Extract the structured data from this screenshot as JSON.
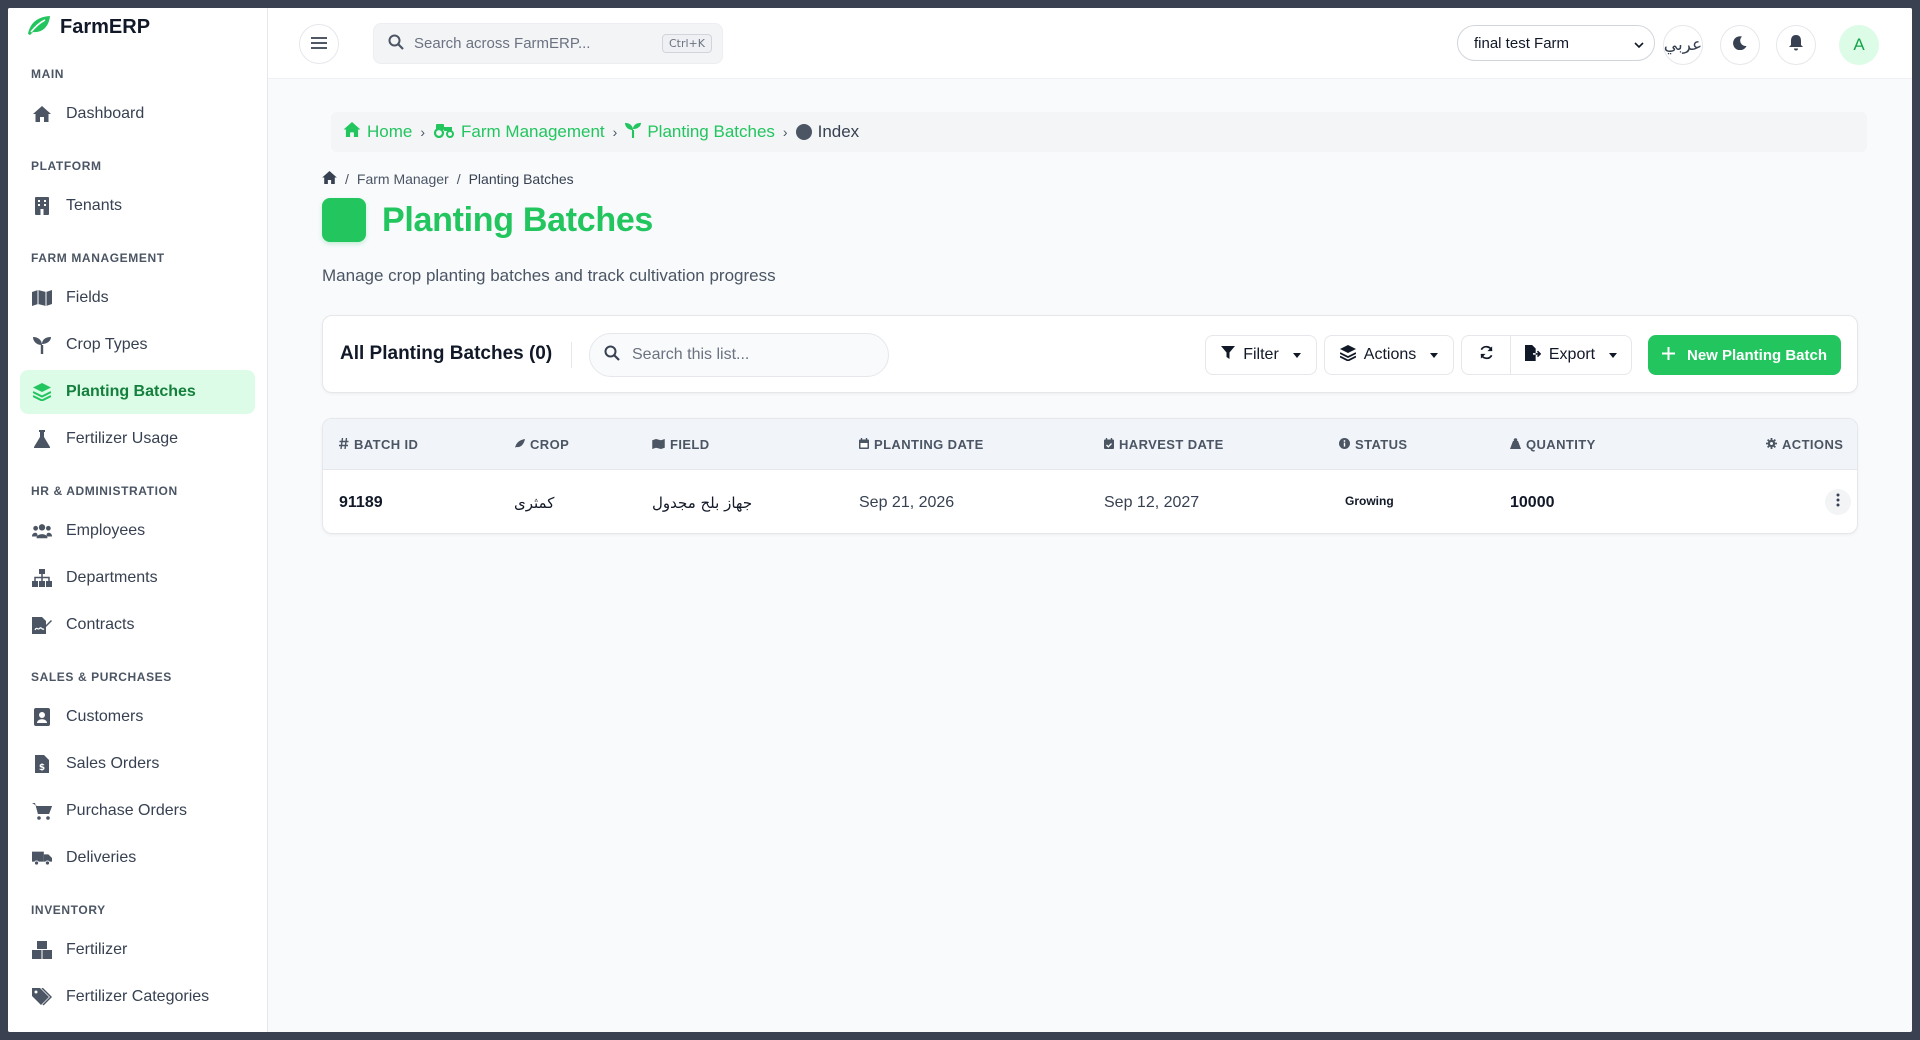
{
  "brand": {
    "name": "FarmERP"
  },
  "sidebar": {
    "sections": {
      "main": "MAIN",
      "platform": "PLATFORM",
      "farm_management": "FARM MANAGEMENT",
      "hr": "HR & ADMINISTRATION",
      "sales": "SALES & PURCHASES",
      "inventory": "INVENTORY"
    },
    "items": {
      "dashboard": "Dashboard",
      "tenants": "Tenants",
      "fields": "Fields",
      "crop_types": "Crop Types",
      "planting_batches": "Planting Batches",
      "fertilizer_usage": "Fertilizer Usage",
      "employees": "Employees",
      "departments": "Departments",
      "contracts": "Contracts",
      "customers": "Customers",
      "sales_orders": "Sales Orders",
      "purchase_orders": "Purchase Orders",
      "deliveries": "Deliveries",
      "fertilizer": "Fertilizer",
      "fertilizer_categories": "Fertilizer Categories"
    },
    "active": "planting_batches"
  },
  "topbar": {
    "search_placeholder": "Search across FarmERP...",
    "search_shortcut": "Ctrl+K",
    "farm_selected": "final test Farm",
    "language_label": "عربي",
    "avatar_initial": "A"
  },
  "breadcrumb": {
    "home": "Home",
    "farm_management": "Farm Management",
    "planting_batches": "Planting Batches",
    "current": "Index"
  },
  "sub_breadcrumb": {
    "farm_manager": "Farm Manager",
    "current": "Planting Batches"
  },
  "page": {
    "title": "Planting Batches",
    "description": "Manage crop planting batches and track cultivation progress"
  },
  "toolbar": {
    "list_title": "All Planting Batches (0)",
    "search_placeholder": "Search this list...",
    "filter_label": "Filter",
    "actions_label": "Actions",
    "export_label": "Export",
    "new_label": "New Planting Batch"
  },
  "table": {
    "headers": {
      "batch_id": "BATCH ID",
      "crop": "CROP",
      "field": "FIELD",
      "planting_date": "PLANTING DATE",
      "harvest_date": "HARVEST DATE",
      "status": "STATUS",
      "quantity": "QUANTITY",
      "actions": "ACTIONS"
    },
    "rows": [
      {
        "batch_id": "91189",
        "crop": "كمثرى",
        "field": "جهاز بلح مجدول",
        "planting_date": "Sep 21, 2026",
        "harvest_date": "Sep 12, 2027",
        "status": "Growing",
        "quantity": "10000"
      }
    ]
  },
  "colors": {
    "accent": "#22c55e",
    "accent_light": "#dcfce7",
    "sidebar_bg": "#ffffff",
    "page_bg": "#f8fafc"
  }
}
